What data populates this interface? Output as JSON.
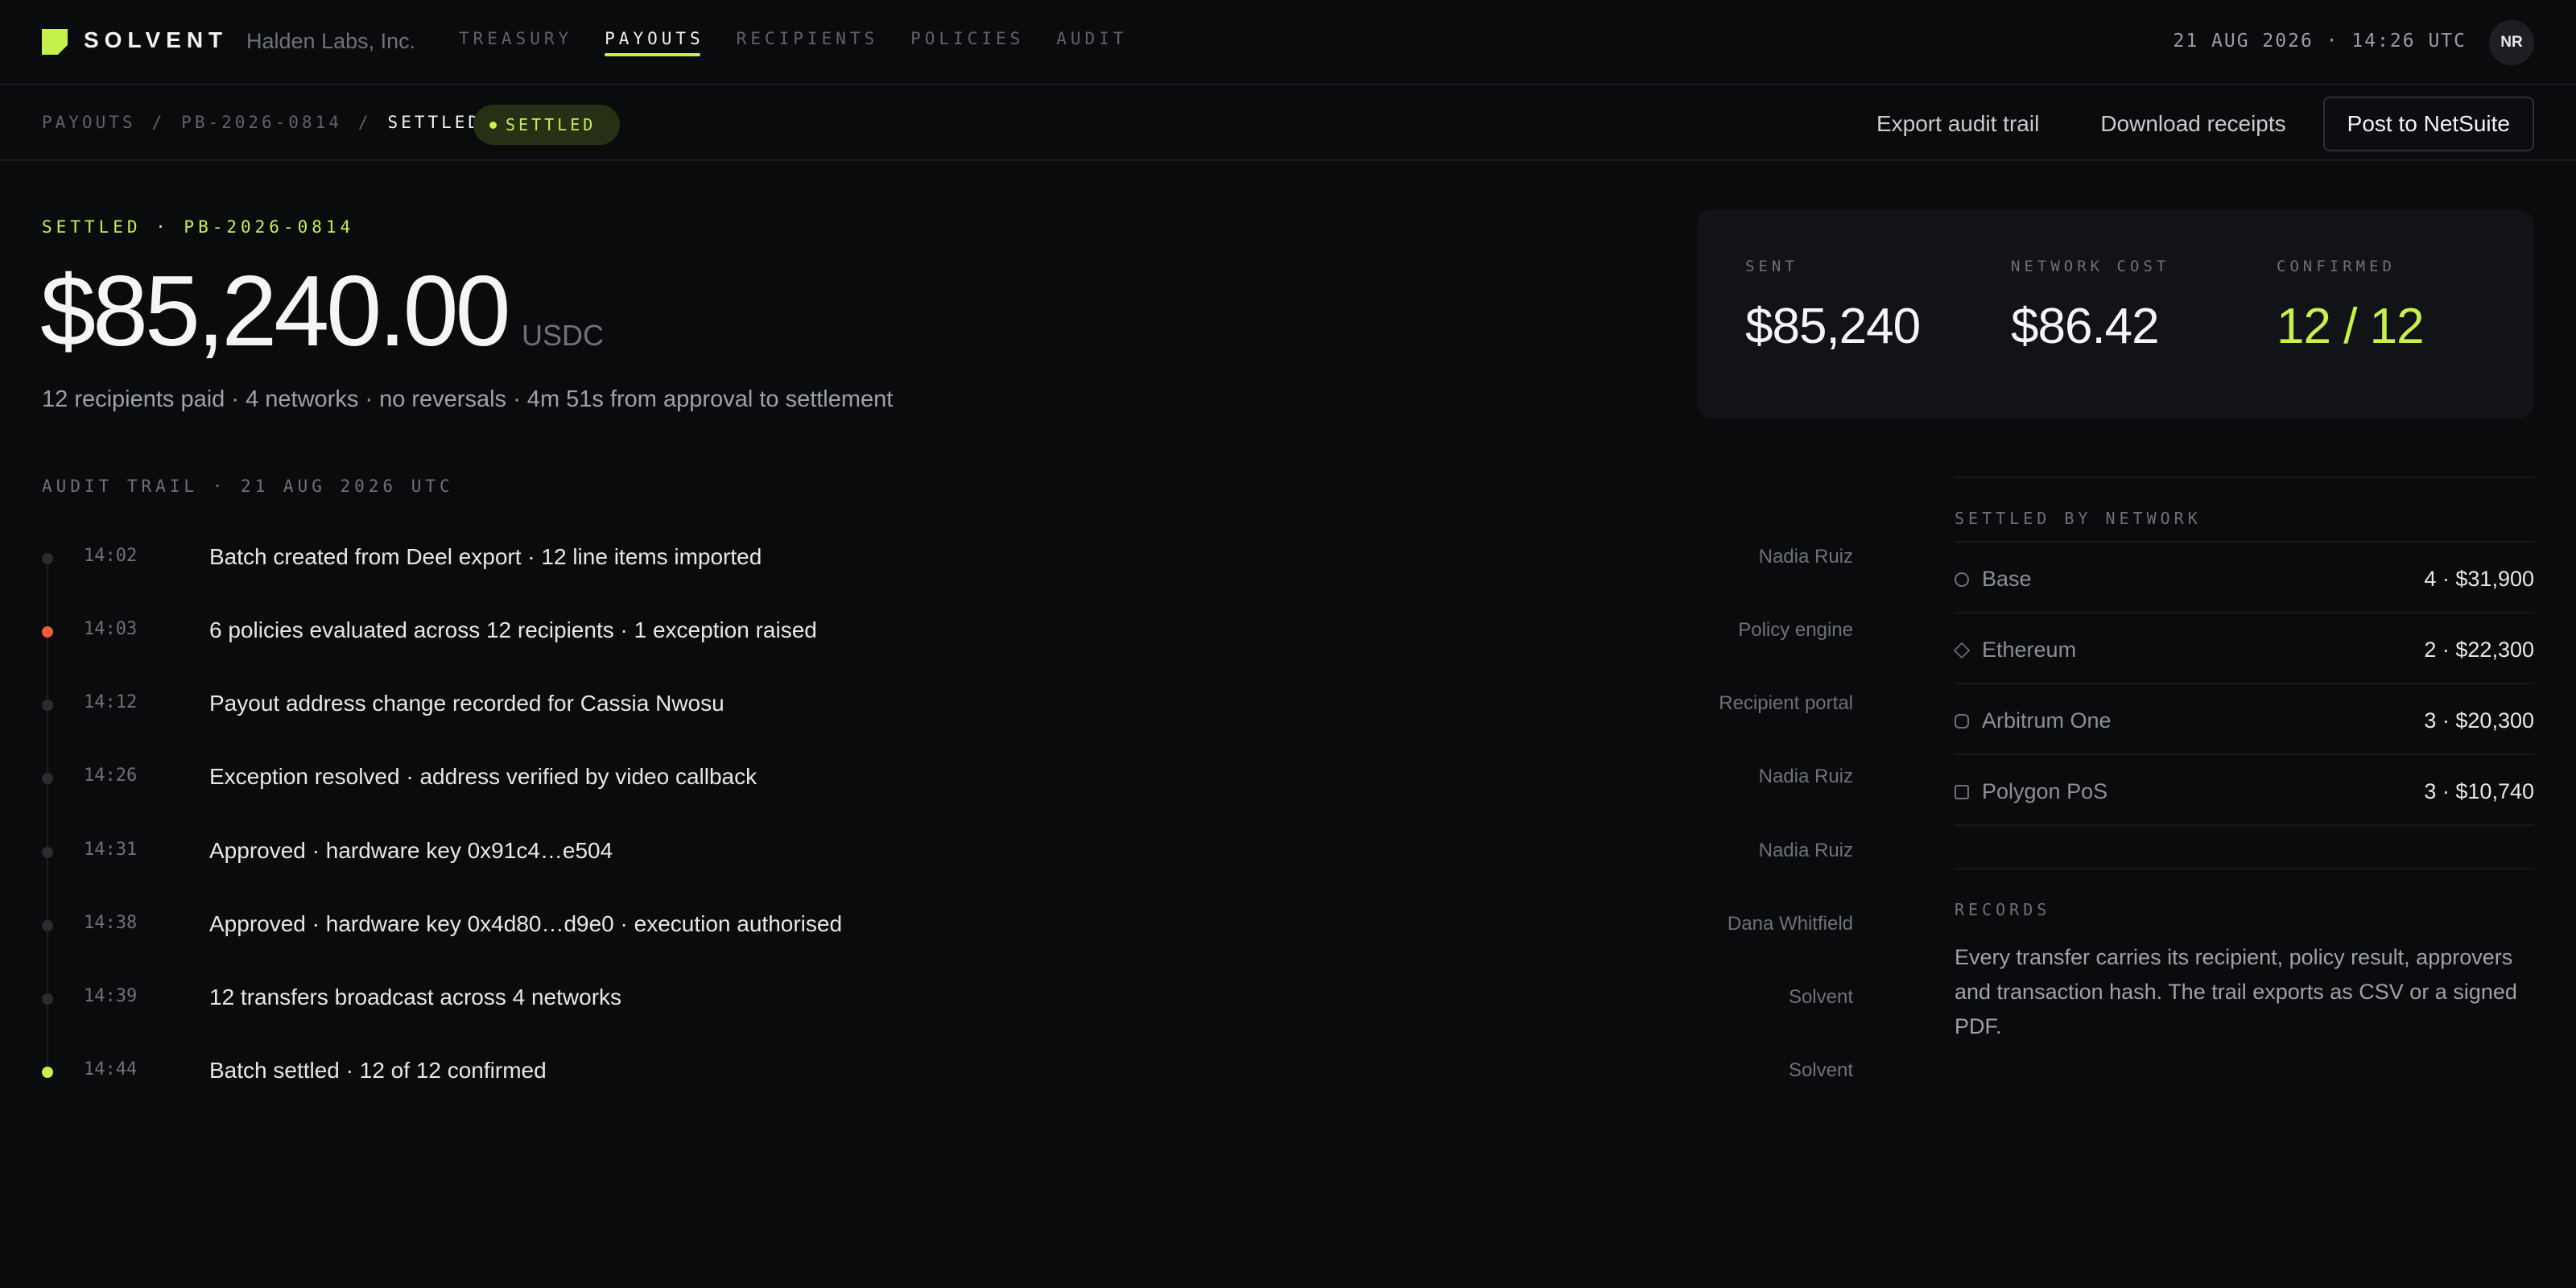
{
  "app": {
    "name": "SOLVENT",
    "org": "Halden Labs, Inc."
  },
  "nav": [
    {
      "label": "TREASURY",
      "active": false
    },
    {
      "label": "PAYOUTS",
      "active": true
    },
    {
      "label": "RECIPIENTS",
      "active": false
    },
    {
      "label": "POLICIES",
      "active": false
    },
    {
      "label": "AUDIT",
      "active": false
    }
  ],
  "header": {
    "datetime": "21 AUG 2026 · 14:26 UTC",
    "avatar": "NR"
  },
  "breadcrumb": {
    "root": "PAYOUTS",
    "batch": "PB-2026-0814",
    "current": "SETTLED",
    "sep": "/"
  },
  "status_badge": "SETTLED",
  "actions": {
    "export": "Export audit trail",
    "download": "Download receipts",
    "post": "Post to NetSuite"
  },
  "hero": {
    "label": "SETTLED · PB-2026-0814",
    "amount": "$85,240.00",
    "currency": "USDC",
    "summary": "12 recipients paid · 4 networks · no reversals · 4m 51s from approval to settlement"
  },
  "stats": [
    {
      "label": "SENT",
      "value": "$85,240"
    },
    {
      "label": "NETWORK COST",
      "value": "$86.42"
    },
    {
      "label": "CONFIRMED",
      "value": "12 / 12"
    }
  ],
  "audit": {
    "title": "AUDIT TRAIL · 21 AUG 2026 UTC",
    "events": [
      {
        "time": "14:02",
        "text": "Batch created from Deel export · 12 line items imported",
        "actor": "Nadia Ruiz",
        "status": "neutral"
      },
      {
        "time": "14:03",
        "text": "6 policies evaluated across 12 recipients · 1 exception raised",
        "actor": "Policy engine",
        "status": "alert"
      },
      {
        "time": "14:12",
        "text": "Payout address change recorded for Cassia Nwosu",
        "actor": "Recipient portal",
        "status": "neutral"
      },
      {
        "time": "14:26",
        "text": "Exception resolved · address verified by video callback",
        "actor": "Nadia Ruiz",
        "status": "neutral"
      },
      {
        "time": "14:31",
        "text": "Approved · hardware key 0x91c4…e504",
        "actor": "Nadia Ruiz",
        "status": "neutral"
      },
      {
        "time": "14:38",
        "text": "Approved · hardware key 0x4d80…d9e0 · execution authorised",
        "actor": "Dana Whitfield",
        "status": "neutral"
      },
      {
        "time": "14:39",
        "text": "12 transfers broadcast across 4 networks",
        "actor": "Solvent",
        "status": "neutral"
      },
      {
        "time": "14:44",
        "text": "Batch settled · 12 of 12 confirmed",
        "actor": "Solvent",
        "status": "success"
      }
    ]
  },
  "networks": {
    "title": "SETTLED BY NETWORK",
    "items": [
      {
        "name": "Base",
        "value": "4 · $31,900",
        "icon": "circle-icon"
      },
      {
        "name": "Ethereum",
        "value": "2 · $22,300",
        "icon": "diamond-icon"
      },
      {
        "name": "Arbitrum One",
        "value": "3 · $20,300",
        "icon": "hexagon-icon"
      },
      {
        "name": "Polygon PoS",
        "value": "3 · $10,740",
        "icon": "square-icon"
      }
    ]
  },
  "records": {
    "title": "RECORDS",
    "text": "Every transfer carries its recipient, policy result, approvers and transaction hash. The trail exports as CSV or a signed PDF."
  },
  "colors": {
    "accent": "#c6f14a",
    "alert": "#ef5b3b",
    "background": "#0a0b0d"
  }
}
